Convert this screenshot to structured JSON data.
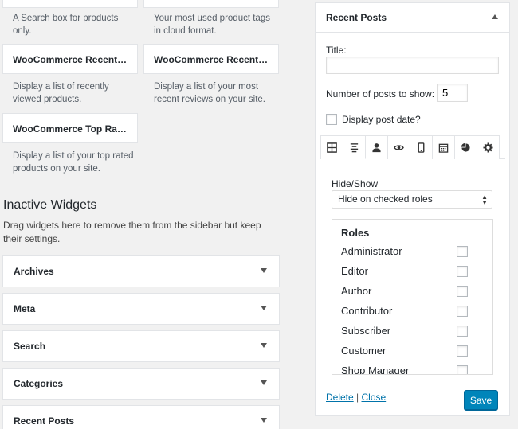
{
  "available_widgets": {
    "search_desc": "A Search box for products only.",
    "tag_cloud_desc": "Your most used product tags in cloud format.",
    "recently_viewed": {
      "label": "WooCommerce Recentl...",
      "desc": "Display a list of recently viewed products."
    },
    "recent_reviews": {
      "label": "WooCommerce Recent ...",
      "desc": "Display a list of your most recent reviews on your site."
    },
    "top_rated": {
      "label": "WooCommerce Top Rat...",
      "desc": "Display a list of your top rated products on your site."
    }
  },
  "inactive": {
    "title": "Inactive Widgets",
    "desc": "Drag widgets here to remove them from the sidebar but keep their settings.",
    "items": [
      {
        "label": "Archives"
      },
      {
        "label": "Meta"
      },
      {
        "label": "Search"
      },
      {
        "label": "Categories"
      },
      {
        "label": "Recent Posts"
      }
    ]
  },
  "panel": {
    "title": "Recent Posts",
    "title_label": "Title:",
    "title_value": "",
    "num_posts_label": "Number of posts to show:",
    "num_posts_value": "5",
    "display_date_label": "Display post date?",
    "tab_icons": [
      "grid-icon",
      "align-center-icon",
      "user-icon",
      "eye-icon",
      "mobile-icon",
      "calendar-icon",
      "pie-chart-icon",
      "gear-icon"
    ],
    "active_tab": "user-icon",
    "hide_show_label": "Hide/Show",
    "hide_show_value": "Hide on checked roles",
    "roles_heading": "Roles",
    "roles": [
      "Administrator",
      "Editor",
      "Author",
      "Contributor",
      "Subscriber",
      "Customer",
      "Shop Manager"
    ],
    "delete_label": "Delete",
    "separator": "|",
    "close_label": "Close",
    "save_label": "Save"
  },
  "colors": {
    "primary_button": "#0085ba",
    "link": "#0073aa",
    "background": "#f1f1f1"
  }
}
